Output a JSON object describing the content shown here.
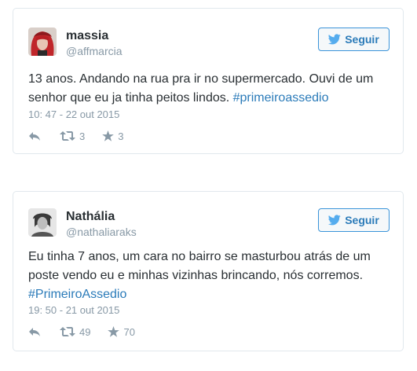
{
  "tweets": [
    {
      "name": "massia",
      "handle": "@affmarcia",
      "follow_label": "Seguir",
      "text_before": "13 anos. Andando na rua pra ir no supermercado. Ouvi de um senhor que eu ja tinha peitos lindos. ",
      "hashtag": "#primeiroassedio",
      "timestamp": "10: 47 - 22 out 2015",
      "retweets": "3",
      "favorites": "3",
      "avatar_icon": "avatar-red-hair",
      "accent_color": "#2b7bb9"
    },
    {
      "name": "Nathália",
      "handle": "@nathaliaraks",
      "follow_label": "Seguir",
      "text_before": "Eu tinha 7 anos, um cara no bairro se masturbou atrás de um poste vendo eu e minhas vizinhas brincando, nós corremos.",
      "hashtag": "#PrimeiroAssedio",
      "timestamp": "19: 50 - 21 out 2015",
      "retweets": "49",
      "favorites": "70",
      "avatar_icon": "avatar-bw-photo",
      "accent_color": "#2b7bb9"
    }
  ],
  "icons": {
    "follow": "twitter-bird-icon",
    "reply": "reply-icon",
    "retweet": "retweet-icon",
    "favorite": "star-icon"
  }
}
